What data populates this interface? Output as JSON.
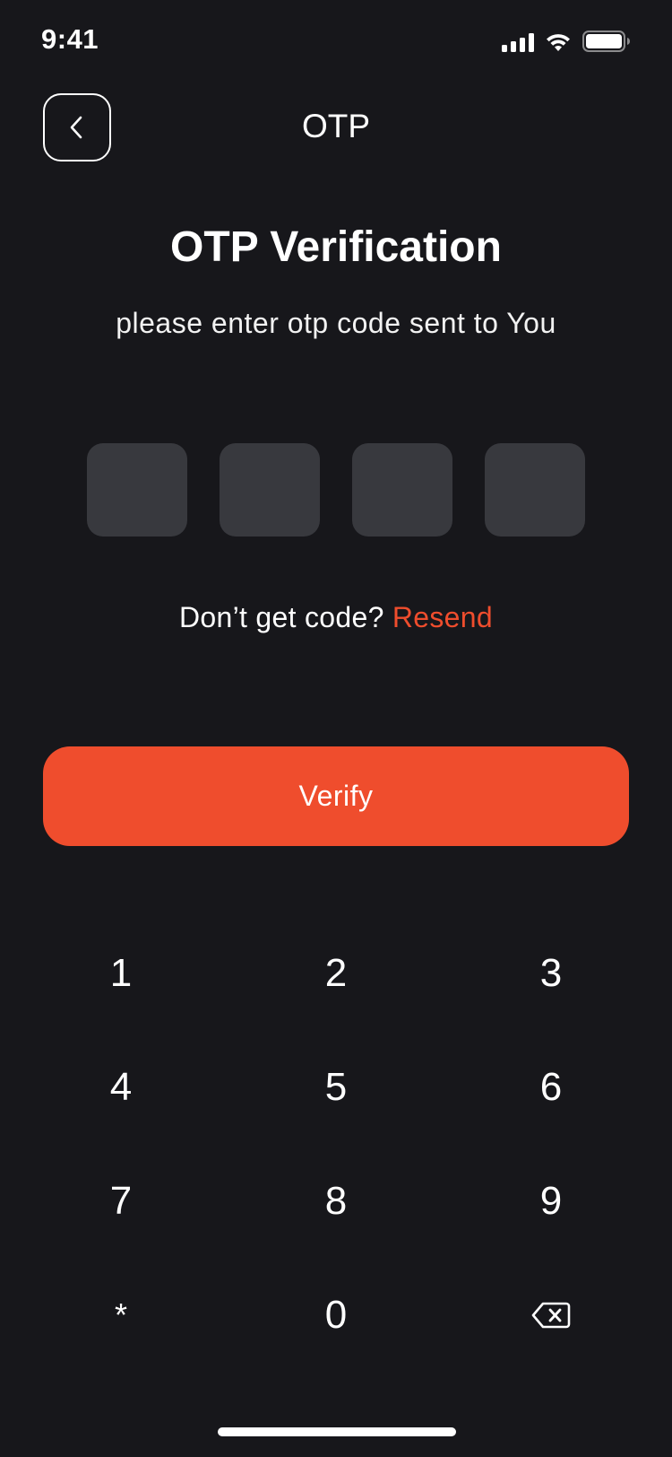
{
  "status_bar": {
    "time": "9:41"
  },
  "header": {
    "title": "OTP",
    "back_icon": "chevron-left-icon"
  },
  "main": {
    "title": "OTP Verification",
    "subtitle": "please enter otp code sent to You",
    "otp": {
      "digits": [
        "",
        "",
        "",
        ""
      ]
    },
    "resend_prompt": "Don’t get code?",
    "resend_link": "Resend",
    "verify_label": "Verify"
  },
  "keypad": {
    "keys": [
      "1",
      "2",
      "3",
      "4",
      "5",
      "6",
      "7",
      "8",
      "9",
      "*",
      "0"
    ],
    "backspace_icon": "backspace-icon"
  },
  "colors": {
    "background": "#17171b",
    "accent": "#ef4d2d",
    "otp_box": "#38393e",
    "text": "#ffffff"
  }
}
